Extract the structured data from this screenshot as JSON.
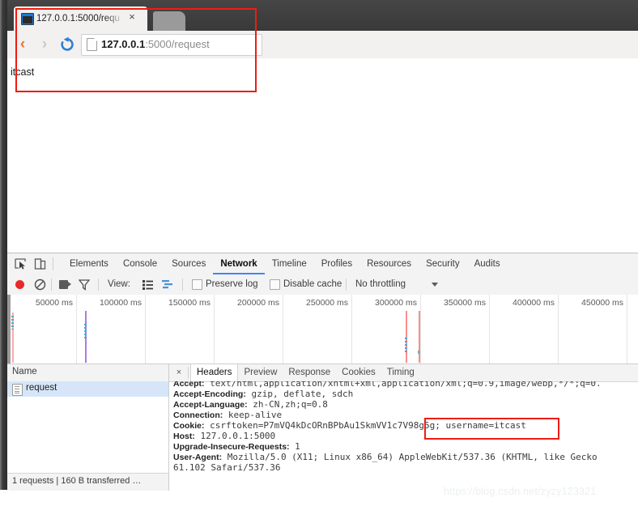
{
  "browser": {
    "tab": {
      "title": "127.0.0.1:5000/requ",
      "close_label": "×",
      "favicon": "terminal-favicon"
    },
    "newtab_label": "",
    "nav": {
      "back": "‹",
      "forward": "›",
      "reload": "reload-icon"
    },
    "omnibox": {
      "host": "127.0.0.1",
      "path": ":5000/request",
      "page_icon": "page-icon"
    },
    "page_content": "itcast"
  },
  "devtools": {
    "panel_tabs": [
      {
        "label": "Elements",
        "active": false
      },
      {
        "label": "Console",
        "active": false
      },
      {
        "label": "Sources",
        "active": false
      },
      {
        "label": "Network",
        "active": true
      },
      {
        "label": "Timeline",
        "active": false
      },
      {
        "label": "Profiles",
        "active": false
      },
      {
        "label": "Resources",
        "active": false
      },
      {
        "label": "Security",
        "active": false
      },
      {
        "label": "Audits",
        "active": false
      }
    ],
    "icons": {
      "inspect": "inspect-element-icon",
      "device": "device-toolbar-icon"
    },
    "toolbar": {
      "record": "record-icon",
      "clear": "clear-icon",
      "camera": "screenshot-camera-icon",
      "filter": "filter-funnel-icon",
      "view_label": "View:",
      "view_large_rows": "large-rows-icon",
      "view_waterfall": "waterfall-icon",
      "preserve_log": "Preserve log",
      "disable_cache": "Disable cache",
      "throttling": "No throttling"
    },
    "overview": {
      "ticks": [
        "50000 ms",
        "100000 ms",
        "150000 ms",
        "200000 ms",
        "250000 ms",
        "300000 ms",
        "350000 ms",
        "400000 ms",
        "450000 ms"
      ]
    },
    "requests": {
      "column_name": "Name",
      "rows": [
        {
          "name": "request",
          "selected": true
        }
      ],
      "status": "1 requests  |  160 B transferred …"
    },
    "details": {
      "close_label": "×",
      "tabs": [
        {
          "label": "Headers",
          "active": true
        },
        {
          "label": "Preview",
          "active": false
        },
        {
          "label": "Response",
          "active": false
        },
        {
          "label": "Cookies",
          "active": false
        },
        {
          "label": "Timing",
          "active": false
        }
      ],
      "headers": [
        {
          "key": "Accept:",
          "value": " text/html,application/xhtml+xml,application/xml;q=0.9,image/webp,*/*;q=0."
        },
        {
          "key": "Accept-Encoding:",
          "value": " gzip, deflate, sdch"
        },
        {
          "key": "Accept-Language:",
          "value": " zh-CN,zh;q=0.8"
        },
        {
          "key": "Connection:",
          "value": " keep-alive"
        },
        {
          "key": "Cookie:",
          "value": " csrftoken=P7mVQ4kDcORnBPbAu1SkmVV1c7V98g5g; username=itcast"
        },
        {
          "key": "Host:",
          "value": " 127.0.0.1:5000"
        },
        {
          "key": "Upgrade-Insecure-Requests:",
          "value": " 1"
        },
        {
          "key": "User-Agent:",
          "value": " Mozilla/5.0 (X11; Linux x86_64) AppleWebKit/537.36 (KHTML, like Gecko"
        },
        {
          "key": "",
          "value": "61.102 Safari/537.36"
        }
      ]
    }
  },
  "annotations": {
    "browser_box": "highlight-browser-window",
    "cookie_box": "highlight-username-cookie"
  },
  "watermark": "https://blog.csdn.net/zyzy123321",
  "colors": {
    "annotation_red": "#ef1c12",
    "record_red": "#e8282a",
    "tab_accent": "#4285f4",
    "selected_row": "#d6e6f8",
    "back_arrow": "#e8742c"
  }
}
